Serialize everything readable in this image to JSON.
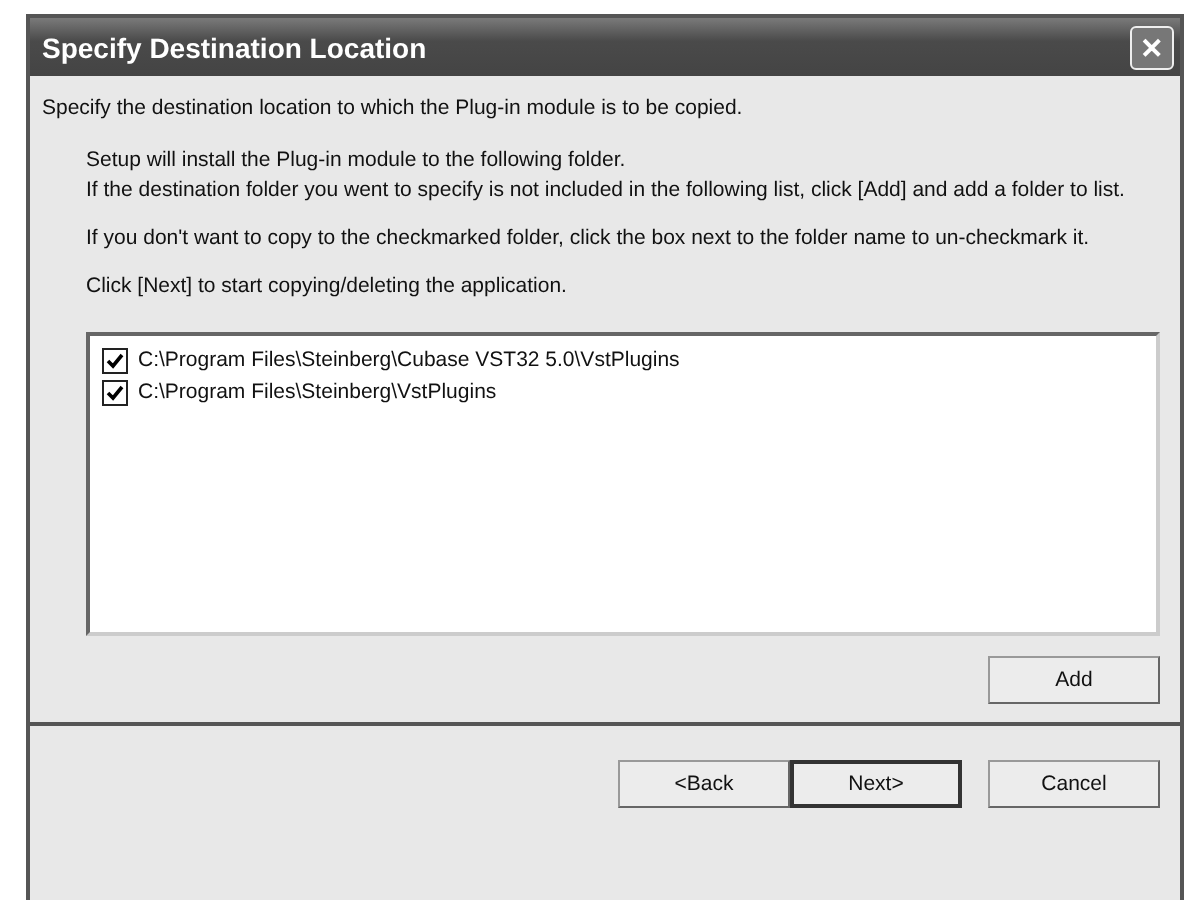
{
  "window": {
    "title": "Specify Destination Location",
    "close": "✕"
  },
  "heading": "Specify the destination location to which the Plug-in module is to be copied.",
  "paragraphs": [
    "Setup will install the Plug-in module to the following folder.\nIf the destination folder you went to specify is not included in the following list, click [Add] and add a folder to list.",
    "If you don't want to copy to the checkmarked folder, click the box next to the folder name to un-checkmark it.",
    "Click [Next] to start copying/deleting the application."
  ],
  "folders": [
    {
      "path": "C:\\Program Files\\Steinberg\\Cubase VST32 5.0\\VstPlugins",
      "checked": true
    },
    {
      "path": "C:\\Program Files\\Steinberg\\VstPlugins",
      "checked": true
    }
  ],
  "add_button": "Add",
  "buttons": [
    {
      "label": "<Back",
      "default": false
    },
    {
      "label": "Next>",
      "default": true
    },
    {
      "label": "Cancel",
      "default": false
    }
  ]
}
